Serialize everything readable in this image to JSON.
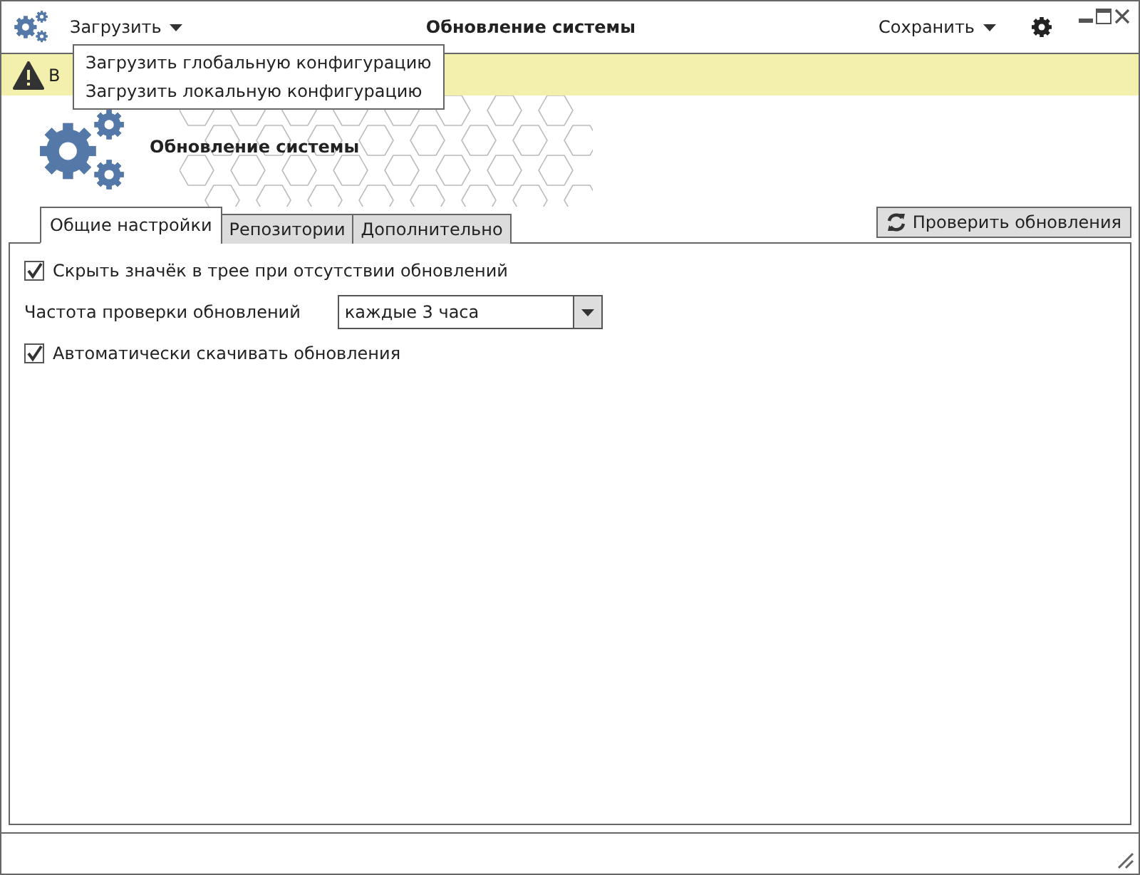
{
  "window": {
    "title": "Обновление системы"
  },
  "menus": [
    {
      "label": "Загрузить",
      "items": [
        "Загрузить глобальную конфигурацию",
        "Загрузить локальную конфигурацию"
      ]
    },
    {
      "label": "Сохранить"
    }
  ],
  "warning": {
    "text": "В"
  },
  "header": {
    "title": "Обновление системы"
  },
  "tabs": [
    {
      "label": "Общие настройки",
      "selected": true
    },
    {
      "label": "Репозитории",
      "selected": false
    },
    {
      "label": "Дополнительно",
      "selected": false
    }
  ],
  "check_button": {
    "label": "Проверить обновления"
  },
  "settings": [
    {
      "kind": "checkbox",
      "label": "Скрыть значёк в трее при отсутствии обновлений",
      "checked": true
    },
    {
      "kind": "select",
      "label": "Частота проверки обновлений",
      "value": "каждые 3 часа"
    },
    {
      "kind": "checkbox",
      "label": "Автоматически скачивать обновления",
      "checked": true
    }
  ]
}
